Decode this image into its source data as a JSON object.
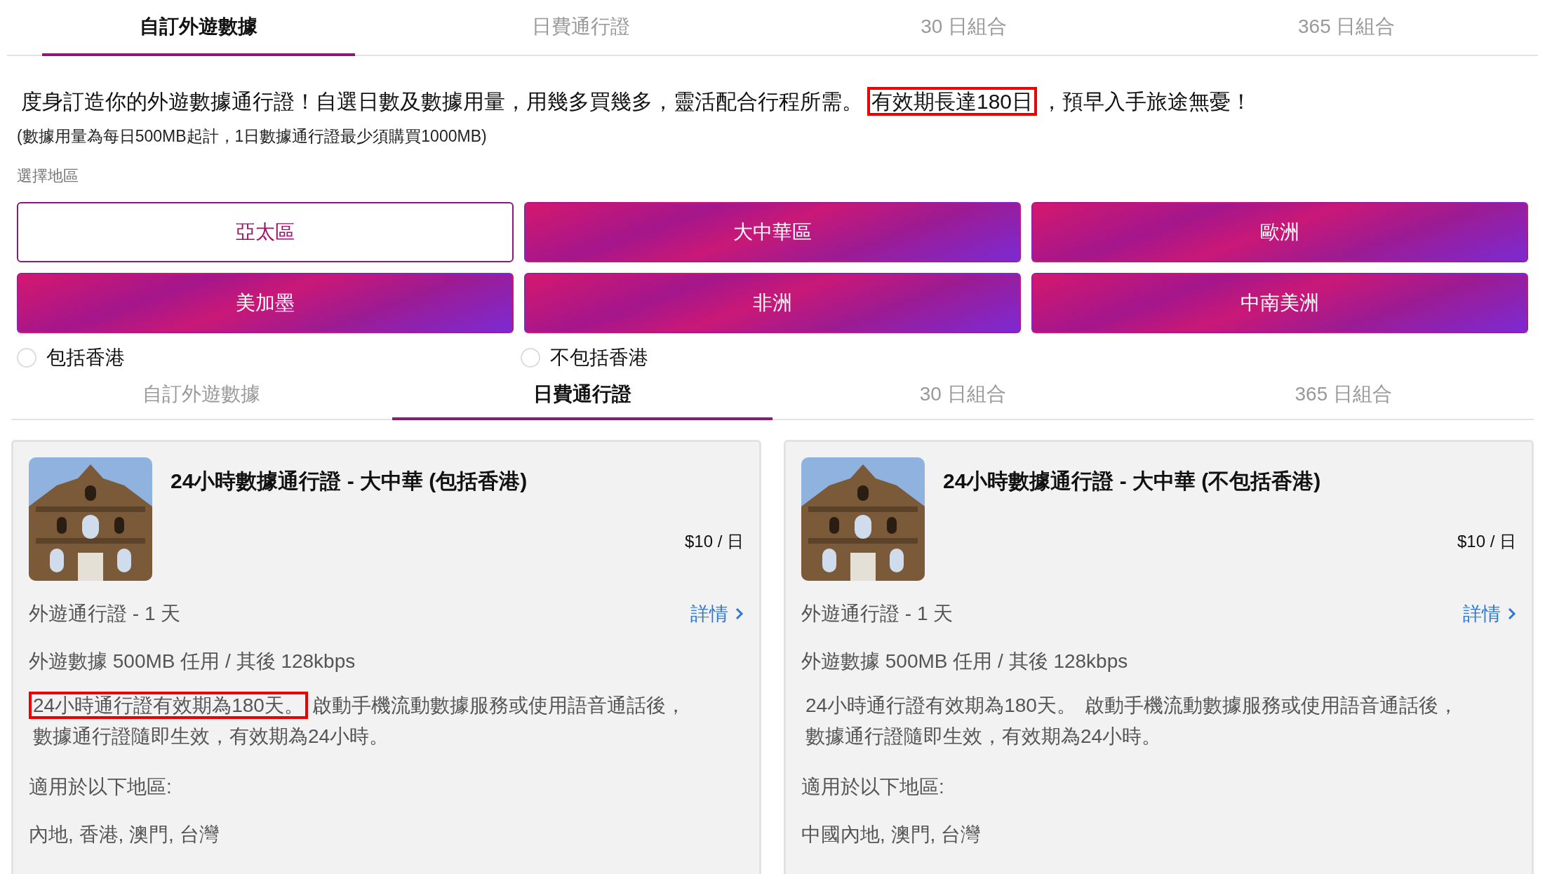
{
  "top_tabs": [
    {
      "label": "自訂外遊數據",
      "selected": true
    },
    {
      "label": "日費通行證",
      "selected": false
    },
    {
      "label": "30 日組合",
      "selected": false
    },
    {
      "label": "365 日組合",
      "selected": false
    }
  ],
  "intro": {
    "segments": [
      {
        "text": "度身訂造你的外遊數據通行證！自選日數及數據用量，用幾多買幾多，靈活配合行程所需。",
        "highlighted": false
      },
      {
        "text": "有效期長達180日",
        "highlighted": true
      },
      {
        "text": "，預早入手旅途無憂！",
        "highlighted": false
      }
    ]
  },
  "note": "(數據用量為每日500MB起計，1日數據通行證最少須購買1000MB)",
  "region_label": "選擇地區",
  "regions": [
    {
      "label": "亞太區",
      "selected": true
    },
    {
      "label": "大中華區",
      "selected": false
    },
    {
      "label": "歐洲",
      "selected": false
    },
    {
      "label": "美加墨",
      "selected": false
    },
    {
      "label": "非洲",
      "selected": false
    },
    {
      "label": "中南美洲",
      "selected": false
    }
  ],
  "radios": [
    {
      "label": "包括香港",
      "selected": false
    },
    {
      "label": "不包括香港",
      "selected": false
    }
  ],
  "plan_tabs": [
    {
      "label": "自訂外遊數據",
      "selected": false
    },
    {
      "label": "日費通行證",
      "selected": true
    },
    {
      "label": "30 日組合",
      "selected": false
    },
    {
      "label": "365 日組合",
      "selected": false
    }
  ],
  "cards": [
    {
      "title": "24小時數據通行證 - 大中華 (包括香港)",
      "price": "$10 / 日",
      "pass": "外遊通行證 - 1 天",
      "details_link": "詳情",
      "data": "外遊數據 500MB 任用 / 其後 128kbps",
      "description": [
        {
          "text": "24小時通行證有效期為180天。",
          "highlighted": true
        },
        {
          "text": "啟動手機流動數據服務或使用語音通話後，數據通行證隨即生效，有效期為24小時。",
          "highlighted": false
        }
      ],
      "areas_label": "適用於以下地區:",
      "areas": "內地, 香港, 澳門, 台灣"
    },
    {
      "title": "24小時數據通行證 - 大中華 (不包括香港)",
      "price": "$10 / 日",
      "pass": "外遊通行證 - 1 天",
      "details_link": "詳情",
      "data": "外遊數據 500MB 任用 / 其後 128kbps",
      "description": [
        {
          "text": "24小時通行證有效期為180天。",
          "highlighted": false
        },
        {
          "text": "啟動手機流動數據服務或使用語音通話後，數據通行證隨即生效，有效期為24小時。",
          "highlighted": false
        }
      ],
      "areas_label": "適用於以下地區:",
      "areas": "中國內地, 澳門, 台灣"
    }
  ]
}
